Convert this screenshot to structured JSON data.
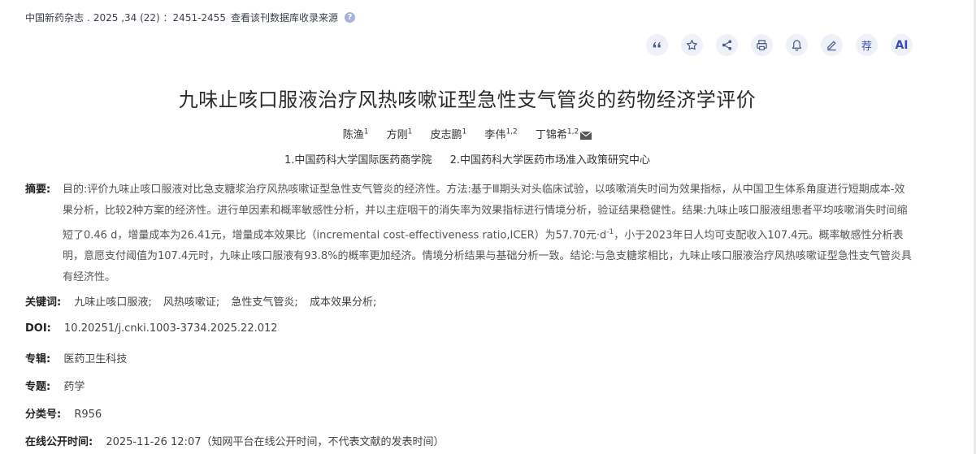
{
  "source": {
    "journal": "中国新药杂志",
    "sep": ".",
    "issue": "2025 ,34 (22) ：2451-2455",
    "db_link": "查看该刊数据库收录来源"
  },
  "toolbar": {
    "icons": [
      "quote-icon",
      "star-icon",
      "share-icon",
      "print-icon",
      "bell-icon",
      "edit-icon",
      "recommend-icon",
      "ai-icon"
    ],
    "recommend_label": "荐",
    "ai_label": "AI"
  },
  "title": "九味止咳口服液治疗风热咳嗽证型急性支气管炎的药物经济学评价",
  "authors": [
    {
      "name": "陈渔",
      "sup": "1"
    },
    {
      "name": "方刚",
      "sup": "1"
    },
    {
      "name": "皮志鹏",
      "sup": "1"
    },
    {
      "name": "李伟",
      "sup": "1,2"
    },
    {
      "name": "丁锦希",
      "sup": "1,2"
    }
  ],
  "affiliations": [
    "1.中国药科大学国际医药商学院",
    "2.中国药科大学医药市场准入政策研究中心"
  ],
  "abstract": {
    "label": "摘要:",
    "part1": "目的:评价九味止咳口服液对比急支糖浆治疗风热咳嗽证型急性支气管炎的经济性。方法:基于Ⅲ期头对头临床试验，以咳嗽消失时间为效果指标，从中国卫生体系角度进行短期成本-效果分析，比较2种方案的经济性。进行单因素和概率敏感性分析，并以主症咽干的消失率为效果指标进行情境分析，验证结果稳健性。结果:九味止咳口服液组患者平均咳嗽消失时间缩短了0.46 d，增量成本为26.41元，增量成本效果比（incremental cost-effectiveness ratio,ICER）为57.70元·d",
    "sup": "-1",
    "part2": "，小于2023年日人均可支配收入107.4元。概率敏感性分析表明，意愿支付阈值为107.4元时，九味止咳口服液有93.8%的概率更加经济。情境分析结果与基础分析一致。结论:与急支糖浆相比，九味止咳口服液治疗风热咳嗽证型急性支气管炎具有经济性。"
  },
  "keywords": {
    "label": "关键词:",
    "items": [
      "九味止咳口服液;",
      "风热咳嗽证;",
      "急性支气管炎;",
      "成本效果分析;"
    ]
  },
  "doi": {
    "label": "DOI:",
    "value": "10.20251/j.cnki.1003-3734.2025.22.012"
  },
  "collection": {
    "label": "专辑:",
    "value": "医药卫生科技"
  },
  "topic": {
    "label": "专题:",
    "value": "药学"
  },
  "classification": {
    "label": "分类号:",
    "value": "R956"
  },
  "online_time": {
    "label": "在线公开时间:",
    "value": "2025-11-26 12:07（知网平台在线公开时间，不代表文献的发表时间）"
  }
}
